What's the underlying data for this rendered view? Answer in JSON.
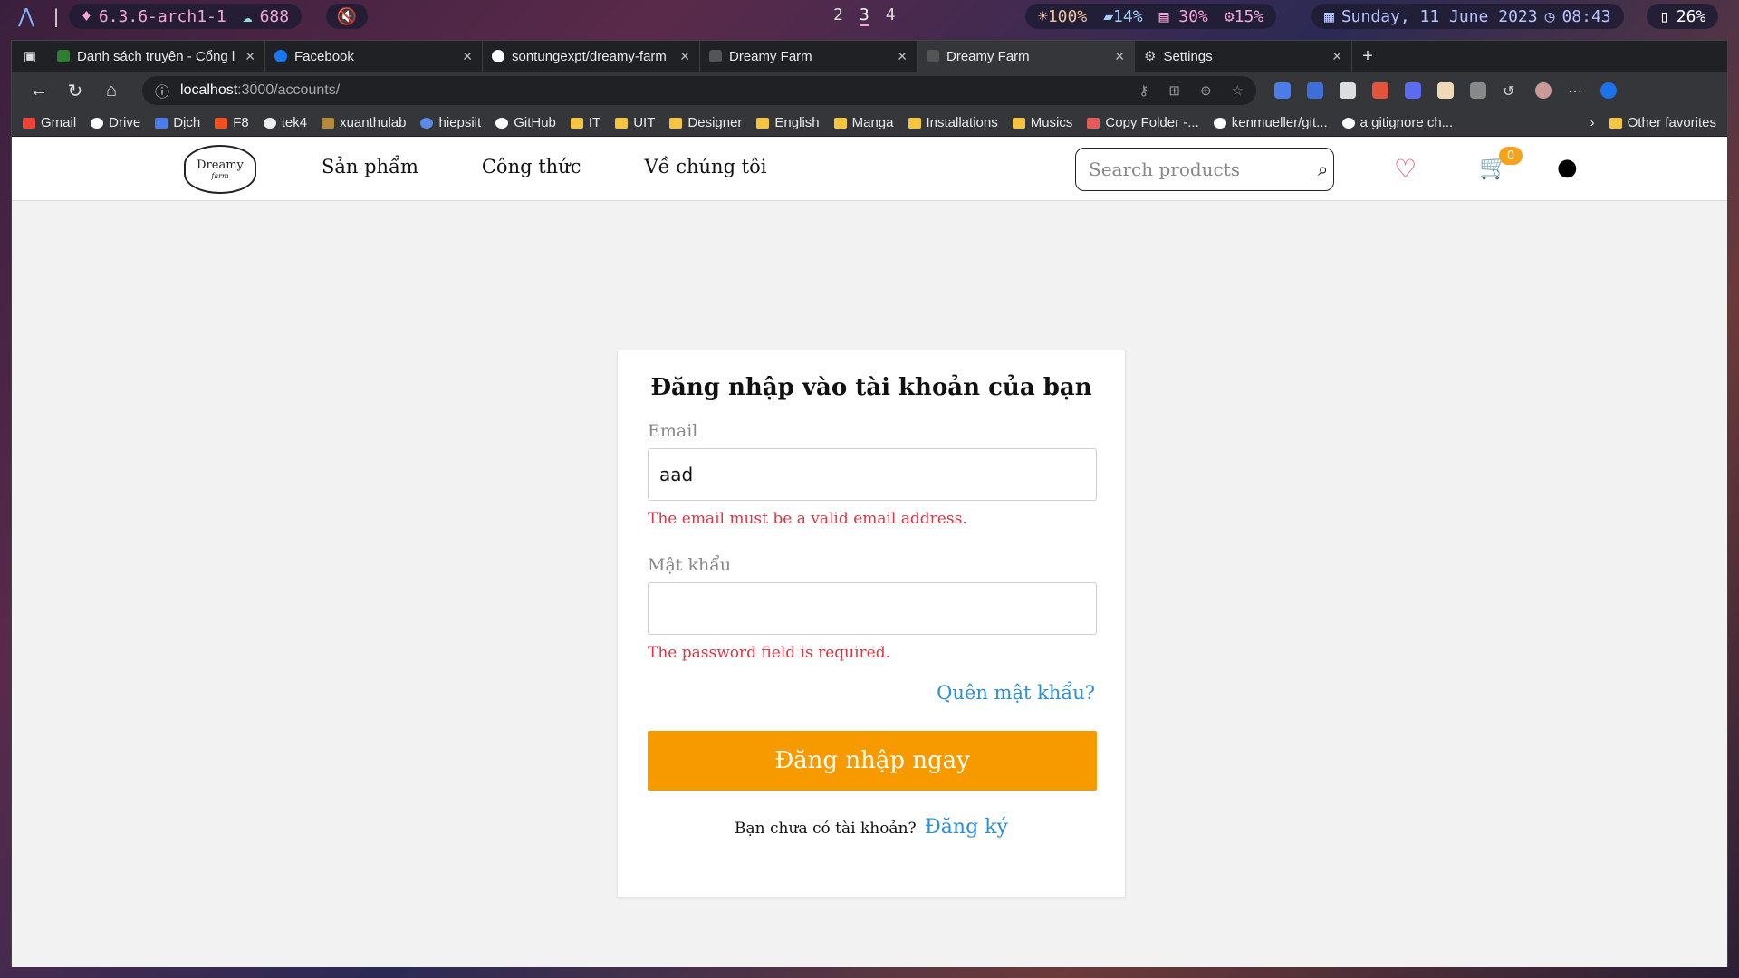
{
  "system_bar": {
    "kernel": "6.3.6-arch1-1",
    "updates": "688",
    "workspaces": [
      "2",
      "3",
      "4"
    ],
    "brightness": "100%",
    "disk": "14%",
    "memory": "30%",
    "cpu": "15%",
    "date": "Sunday, 11 June 2023",
    "time": "08:43",
    "battery": "26%"
  },
  "browser": {
    "tabs": [
      {
        "title": "Danh sách truyện - Cổng l",
        "favicon_color": "#2e7d32"
      },
      {
        "title": "Facebook",
        "favicon_color": "#1877f2"
      },
      {
        "title": "sontungexpt/dreamy-farm",
        "favicon_color": "#ffffff"
      },
      {
        "title": "Dreamy Farm",
        "favicon_color": "#555555"
      },
      {
        "title": "Dreamy Farm",
        "favicon_color": "#555555",
        "active": true
      },
      {
        "title": "Settings",
        "favicon_color": "#cccccc"
      }
    ],
    "url_host": "localhost",
    "url_path": ":3000/accounts/",
    "bookmarks": [
      {
        "label": "Gmail",
        "type": "site"
      },
      {
        "label": "Drive",
        "type": "site"
      },
      {
        "label": "Dịch",
        "type": "site"
      },
      {
        "label": "F8",
        "type": "site"
      },
      {
        "label": "tek4",
        "type": "site"
      },
      {
        "label": "xuanthulab",
        "type": "site"
      },
      {
        "label": "hiepsiit",
        "type": "site"
      },
      {
        "label": "GitHub",
        "type": "site"
      },
      {
        "label": "IT",
        "type": "folder"
      },
      {
        "label": "UIT",
        "type": "folder"
      },
      {
        "label": "Designer",
        "type": "folder"
      },
      {
        "label": "English",
        "type": "folder"
      },
      {
        "label": "Manga",
        "type": "folder"
      },
      {
        "label": "Installations",
        "type": "folder"
      },
      {
        "label": "Musics",
        "type": "folder"
      },
      {
        "label": "Copy Folder -...",
        "type": "site"
      },
      {
        "label": "kenmueller/git...",
        "type": "site"
      },
      {
        "label": "a gitignore ch...",
        "type": "site"
      }
    ],
    "other_favorites": "Other favorites"
  },
  "site": {
    "logo_text": "Dreamy",
    "logo_sub": "farm",
    "menu": [
      "Sản phẩm",
      "Công thức",
      "Về chúng tôi"
    ],
    "search_placeholder": "Search products",
    "cart_count": "0"
  },
  "login": {
    "title": "Đăng nhập vào tài khoản của bạn",
    "email_label": "Email",
    "email_value": "aad",
    "email_error": "The email must be a valid email address.",
    "password_label": "Mật khẩu",
    "password_value": "",
    "password_error": "The password field is required.",
    "forgot": "Quên mật khẩu?",
    "submit": "Đăng nhập ngay",
    "no_account": "Bạn chưa có tài khoản?",
    "signup": "Đăng ký"
  },
  "colors": {
    "accent": "#f79a00",
    "link": "#2a8fd6",
    "error": "#dc3545",
    "heart": "#e53951"
  }
}
